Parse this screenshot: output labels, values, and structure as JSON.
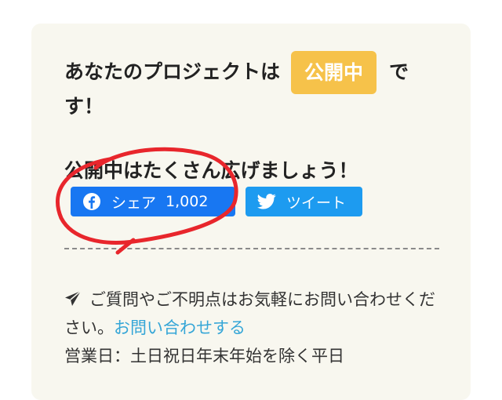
{
  "status": {
    "prefix": "あなたのプロジェクトは",
    "badge": "公開中",
    "suffix": "で",
    "tail": "す！"
  },
  "share": {
    "heading": "公開中はたくさん広げましょう！",
    "facebook_label": "シェア",
    "facebook_count": "1,002",
    "twitter_label": "ツイート"
  },
  "contact": {
    "text": "ご質問やご不明点はお気軽にお問い合わせください。",
    "link_text": "お問い合わせする",
    "hours": "営業日：土日祝日年末年始を除く平日"
  },
  "colors": {
    "badge": "#f6c24a",
    "facebook": "#1877f2",
    "twitter": "#1d9bf0",
    "link": "#35a6d7",
    "annotation": "#e8262c"
  }
}
